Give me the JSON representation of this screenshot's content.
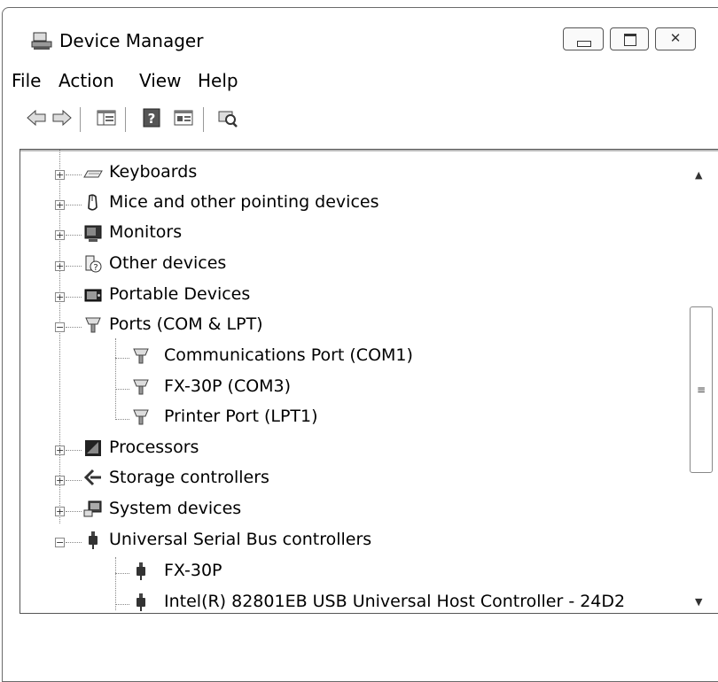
{
  "window": {
    "title": "Device Manager",
    "icon": "device-manager-icon",
    "controls": {
      "minimize": "minimize-icon",
      "maximize": "maximize-icon",
      "close": "close-icon",
      "close_glyph": "✕"
    }
  },
  "menu": {
    "items": [
      "File",
      "Action",
      "View",
      "Help"
    ]
  },
  "toolbar": {
    "buttons": [
      "back-arrow-icon",
      "forward-arrow-icon",
      "show-hide-console-tree-icon",
      "help-icon",
      "properties-icon",
      "scan-hardware-icon"
    ]
  },
  "tree": {
    "nodes": [
      {
        "label": "Keyboards",
        "expander": "+",
        "icon": "keyboard-icon"
      },
      {
        "label": "Mice and other pointing devices",
        "expander": "+",
        "icon": "mouse-icon"
      },
      {
        "label": "Monitors",
        "expander": "+",
        "icon": "monitor-icon"
      },
      {
        "label": "Other devices",
        "expander": "+",
        "icon": "unknown-device-icon"
      },
      {
        "label": "Portable Devices",
        "expander": "+",
        "icon": "portable-device-icon"
      },
      {
        "label": "Ports (COM & LPT)",
        "expander": "−",
        "icon": "port-icon",
        "children": [
          "Communications Port (COM1)",
          "FX-30P (COM3)",
          "Printer Port (LPT1)"
        ]
      },
      {
        "label": "Processors",
        "expander": "+",
        "icon": "processor-icon"
      },
      {
        "label": "Storage controllers",
        "expander": "+",
        "icon": "storage-controller-icon"
      },
      {
        "label": "System devices",
        "expander": "+",
        "icon": "system-device-icon"
      },
      {
        "label": "Universal Serial Bus controllers",
        "expander": "−",
        "icon": "usb-icon",
        "children": [
          "FX-30P",
          "Intel(R) 82801EB USB Universal Host Controller - 24D2"
        ]
      }
    ]
  },
  "scrollbar": {
    "up": "▲",
    "down": "▼",
    "grip": "≡"
  }
}
